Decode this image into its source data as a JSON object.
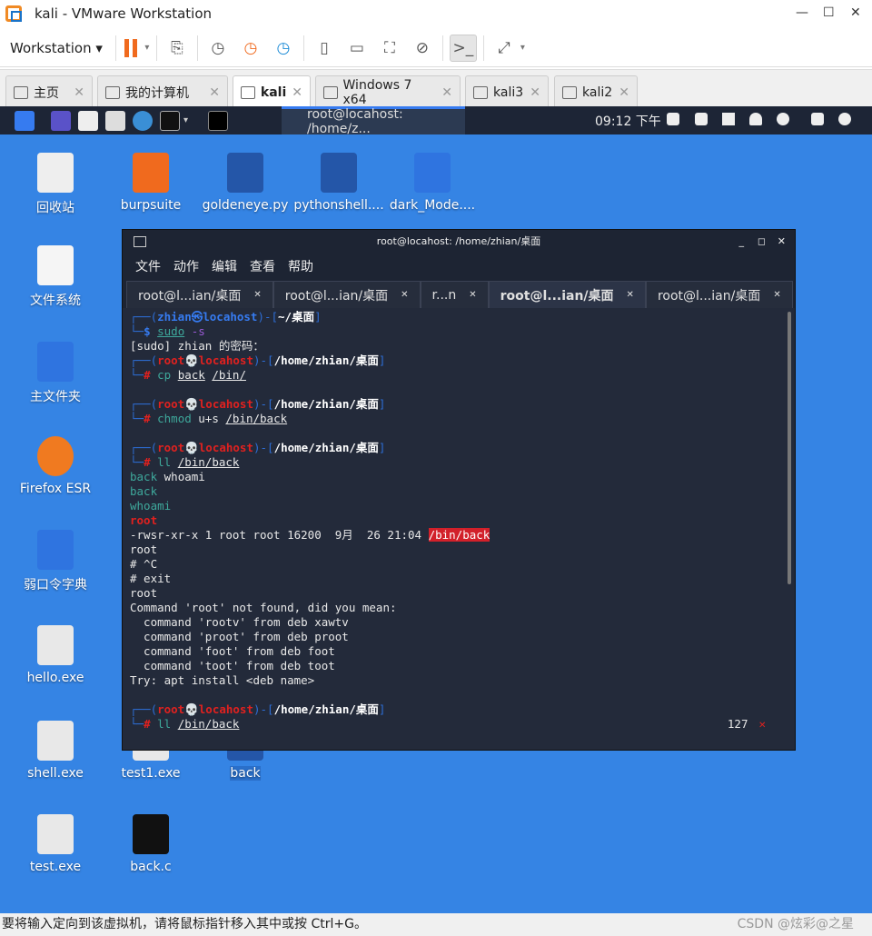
{
  "window": {
    "title": "kali - VMware Workstation"
  },
  "toolbar": {
    "workstation_label": "Workstation"
  },
  "vm_tabs": [
    {
      "label": "主页"
    },
    {
      "label": "我的计算机"
    },
    {
      "label": "kali",
      "active": true
    },
    {
      "label": "Windows 7 x64"
    },
    {
      "label": "kali3"
    },
    {
      "label": "kali2"
    }
  ],
  "panel": {
    "task_label": "root@locahost: /home/z...",
    "clock": "09:12 下午"
  },
  "desktop_icons": [
    {
      "label": "回收站",
      "icon": "trash-icon"
    },
    {
      "label": "burpsuite",
      "icon": "burpsuite-icon"
    },
    {
      "label": "goldeneye.py",
      "icon": "python-file-icon"
    },
    {
      "label": "pythonshell....",
      "icon": "python-file-icon"
    },
    {
      "label": "dark_Mode....",
      "icon": "folder-icon"
    },
    {
      "label": "文件系统",
      "icon": "drive-icon"
    },
    {
      "label": "主文件夹",
      "icon": "home-folder-icon"
    },
    {
      "label": "Firefox ESR",
      "icon": "firefox-icon"
    },
    {
      "label": "弱口令字典",
      "icon": "folder-icon"
    },
    {
      "label": "hello.exe",
      "icon": "exe-icon"
    },
    {
      "label": "shell.exe",
      "icon": "exe-locked-icon"
    },
    {
      "label": "test1.exe",
      "icon": "exe-locked-icon"
    },
    {
      "label": "back",
      "icon": "binary-locked-icon",
      "selected": true
    },
    {
      "label": "test.exe",
      "icon": "exe-locked-icon"
    },
    {
      "label": "back.c",
      "icon": "c-file-locked-icon"
    }
  ],
  "terminal": {
    "title": "root@locahost: /home/zhian/桌面",
    "menu": [
      "文件",
      "动作",
      "编辑",
      "查看",
      "帮助"
    ],
    "tabs": [
      {
        "label": "root@l...ian/桌面"
      },
      {
        "label": "root@l...ian/桌面"
      },
      {
        "label": "r...n"
      },
      {
        "label": "root@l...ian/桌面",
        "active": true
      },
      {
        "label": "root@l...ian/桌面"
      }
    ],
    "lines": [
      [
        [
          "┌──(",
          "blue"
        ],
        [
          "zhian㉿locahost",
          "bb"
        ],
        [
          ")-[",
          "blue"
        ],
        [
          "~/桌面",
          "w"
        ],
        [
          "]",
          "blue"
        ]
      ],
      [
        [
          "└─",
          "blue"
        ],
        [
          "$ ",
          "bb"
        ],
        [
          "sudo",
          "g u"
        ],
        [
          " -s",
          "purple"
        ]
      ],
      [
        [
          "[sudo] zhian 的密码：",
          ""
        ]
      ],
      [
        [
          "┌──(",
          "blue"
        ],
        [
          "root💀locahost",
          "red"
        ],
        [
          ")-[",
          "blue"
        ],
        [
          "/home/zhian/桌面",
          "w"
        ],
        [
          "]",
          "blue"
        ]
      ],
      [
        [
          "└─",
          "blue"
        ],
        [
          "# ",
          "red"
        ],
        [
          "cp ",
          "g"
        ],
        [
          "back",
          "u"
        ],
        [
          " ",
          ""
        ],
        [
          "/bin/",
          "u"
        ]
      ],
      [],
      [
        [
          "┌──(",
          "blue"
        ],
        [
          "root💀locahost",
          "red"
        ],
        [
          ")-[",
          "blue"
        ],
        [
          "/home/zhian/桌面",
          "w"
        ],
        [
          "]",
          "blue"
        ]
      ],
      [
        [
          "└─",
          "blue"
        ],
        [
          "# ",
          "red"
        ],
        [
          "chmod ",
          "g"
        ],
        [
          "u+s ",
          ""
        ],
        [
          "/bin/back",
          "u"
        ]
      ],
      [],
      [
        [
          "┌──(",
          "blue"
        ],
        [
          "root💀locahost",
          "red"
        ],
        [
          ")-[",
          "blue"
        ],
        [
          "/home/zhian/桌面",
          "w"
        ],
        [
          "]",
          "blue"
        ]
      ],
      [
        [
          "└─",
          "blue"
        ],
        [
          "# ",
          "red"
        ],
        [
          "ll ",
          "g"
        ],
        [
          "/bin/back",
          "u"
        ]
      ],
      [
        [
          "back ",
          "teal"
        ],
        [
          "whoami",
          ""
        ]
      ],
      [
        [
          "back",
          "teal"
        ]
      ],
      [
        [
          "whoami",
          "teal"
        ]
      ],
      [
        [
          "root",
          "red"
        ]
      ],
      [
        [
          "-rwsr-xr-x 1 root root 16200  9月  26 21:04 ",
          ""
        ],
        [
          "/bin/back",
          "hl"
        ]
      ],
      [
        [
          "root",
          ""
        ]
      ],
      [
        [
          "# ^C",
          ""
        ]
      ],
      [
        [
          "# exit",
          ""
        ]
      ],
      [
        [
          "root",
          ""
        ]
      ],
      [
        [
          "Command 'root' not found, did you mean:",
          ""
        ]
      ],
      [
        [
          "  command 'rootv' from deb xawtv",
          ""
        ]
      ],
      [
        [
          "  command 'proot' from deb proot",
          ""
        ]
      ],
      [
        [
          "  command 'foot' from deb foot",
          ""
        ]
      ],
      [
        [
          "  command 'toot' from deb toot",
          ""
        ]
      ],
      [
        [
          "Try: apt install <deb name>",
          ""
        ]
      ],
      [],
      [
        [
          "┌──(",
          "blue"
        ],
        [
          "root💀locahost",
          "red"
        ],
        [
          ")-[",
          "blue"
        ],
        [
          "/home/zhian/桌面",
          "w"
        ],
        [
          "]",
          "blue"
        ]
      ],
      [
        [
          "└─",
          "blue"
        ],
        [
          "# ",
          "red"
        ],
        [
          "ll ",
          "g"
        ],
        [
          "/bin/back",
          "u"
        ]
      ]
    ],
    "exit_code": "127",
    "exit_mark": "✕"
  },
  "status": {
    "text": "要将输入定向到该虚拟机，请将鼠标指针移入其中或按 Ctrl+G。",
    "watermark": "CSDN @炫彩@之星"
  }
}
